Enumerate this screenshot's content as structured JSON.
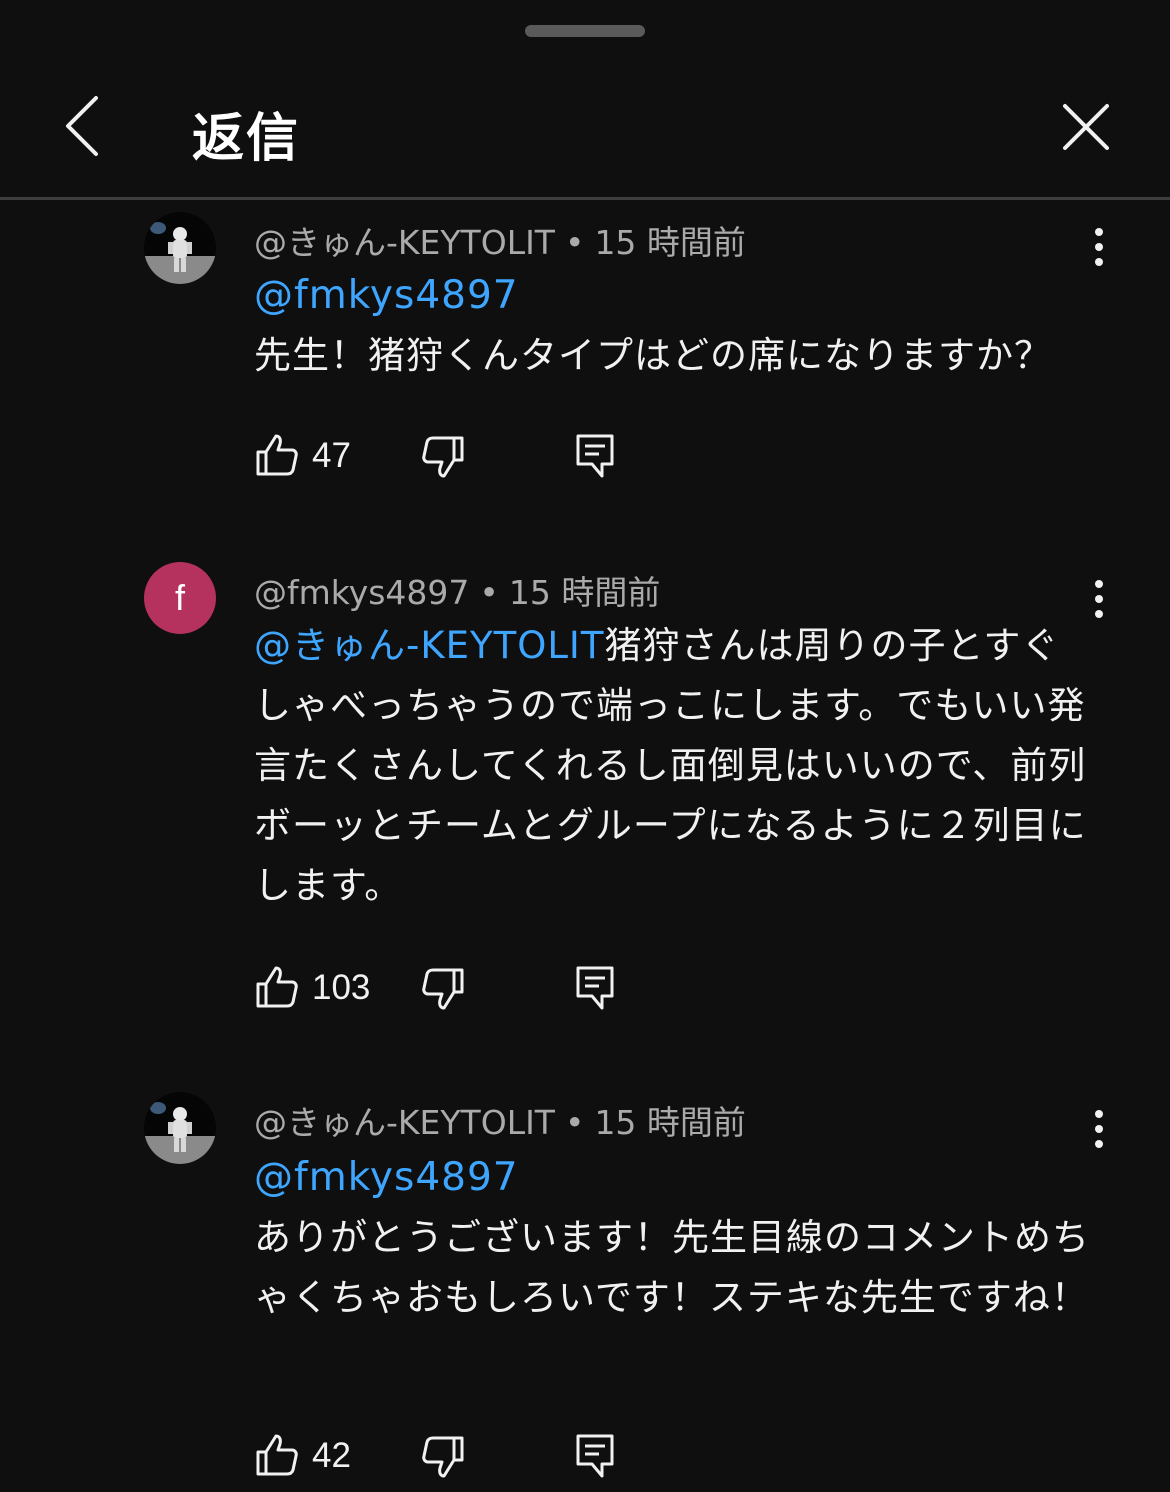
{
  "header": {
    "title": "返信"
  },
  "comments": [
    {
      "author": "@きゅん-KEYTOLIT",
      "time": "15 時間前",
      "mention": "@fmkys4897",
      "text": "先生！猪狩くんタイプはどの席になりますか？",
      "likes": "47",
      "avatar": "astronaut"
    },
    {
      "author": "@fmkys4897",
      "time": "15 時間前",
      "mention": "@きゅん-KEYTOLIT",
      "text": "猪狩さんは周りの子とすぐしゃべっちゃうので端っこにします。でもいい発言たくさんしてくれるし面倒見はいいので、前列ボーッとチームとグループになるように２列目にします。",
      "likes": "103",
      "avatar_letter": "f",
      "avatar_color": "#b5325e"
    },
    {
      "author": "@きゅん-KEYTOLIT",
      "time": "15 時間前",
      "mention": "@fmkys4897",
      "text": "ありがとうございます！先生目線のコメントめちゃくちゃおもしろいです！ステキな先生ですね！",
      "likes": "42",
      "avatar": "astronaut"
    }
  ],
  "separator": "•",
  "colors": {
    "background": "#0f0f0f",
    "mention": "#3ea6ff",
    "meta": "#aaaaaa"
  }
}
